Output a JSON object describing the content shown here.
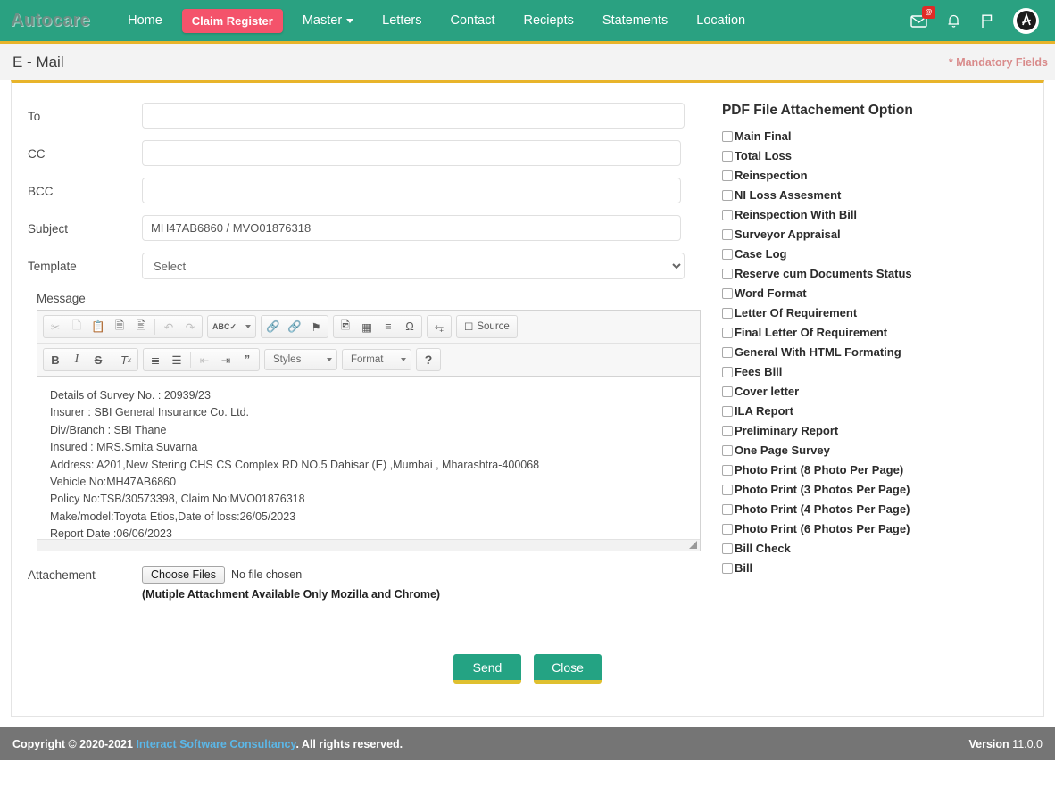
{
  "navbar": {
    "brand": "Autocare",
    "links": [
      {
        "label": "Home",
        "type": "link"
      },
      {
        "label": "Claim Register",
        "type": "pill"
      },
      {
        "label": "Master",
        "type": "dropdown"
      },
      {
        "label": "Letters",
        "type": "link"
      },
      {
        "label": "Contact",
        "type": "link"
      },
      {
        "label": "Reciepts",
        "type": "link"
      },
      {
        "label": "Statements",
        "type": "link"
      },
      {
        "label": "Location",
        "type": "link"
      }
    ],
    "icons": [
      {
        "name": "mail-icon",
        "badge": "@"
      },
      {
        "name": "bell-icon",
        "badge": ""
      },
      {
        "name": "flag-icon",
        "badge": ""
      },
      {
        "name": "avatar",
        "badge": ""
      }
    ],
    "mail_badge": "@",
    "bg_color": "#2aa181",
    "pill_color": "#f4536b"
  },
  "page": {
    "title": "E - Mail",
    "mandatory_note": "* Mandatory Fields",
    "accent_color": "#e8b42a"
  },
  "form": {
    "to": {
      "label": "To",
      "value": "",
      "placeholder": ""
    },
    "cc": {
      "label": "CC",
      "value": "",
      "placeholder": ""
    },
    "bcc": {
      "label": "BCC",
      "value": "",
      "placeholder": ""
    },
    "subject": {
      "label": "Subject",
      "value": "MH47AB6860 / MVO01876318",
      "placeholder": ""
    },
    "template": {
      "label": "Template",
      "selected": "Select",
      "options": [
        "Select"
      ]
    },
    "message_label": "Message"
  },
  "editor": {
    "toolbar_row1": [
      {
        "group": [
          {
            "name": "cut-icon",
            "glyph": "✂"
          },
          {
            "name": "copy-icon",
            "glyph": "❐"
          },
          {
            "name": "paste-icon",
            "glyph": "ὌB"
          },
          {
            "name": "paste-text-icon",
            "glyph": "T"
          },
          {
            "name": "paste-word-icon",
            "glyph": "W"
          },
          {
            "name": "separator",
            "glyph": "|"
          },
          {
            "name": "undo-icon",
            "glyph": "↶"
          },
          {
            "name": "redo-icon",
            "glyph": "↷"
          }
        ]
      },
      {
        "group": [
          {
            "name": "spellcheck-icon",
            "glyph": "ABC"
          }
        ]
      },
      {
        "group": [
          {
            "name": "link-icon",
            "glyph": "ὑ7"
          },
          {
            "name": "unlink-icon",
            "glyph": "⛓"
          },
          {
            "name": "anchor-icon",
            "glyph": "⚑"
          }
        ]
      },
      {
        "group": [
          {
            "name": "image-icon",
            "glyph": "ὛC"
          },
          {
            "name": "table-icon",
            "glyph": "⊞"
          },
          {
            "name": "horizontal-rule-icon",
            "glyph": "≡"
          },
          {
            "name": "special-char-icon",
            "glyph": "Ω"
          }
        ]
      },
      {
        "group": [
          {
            "name": "maximize-icon",
            "glyph": "⤢"
          }
        ]
      },
      {
        "group": [
          {
            "name": "source-button",
            "glyph": "Source"
          }
        ]
      }
    ],
    "source_label": "Source",
    "toolbar_row2": [
      {
        "group": [
          {
            "name": "bold-icon",
            "glyph": "B"
          },
          {
            "name": "italic-icon",
            "glyph": "I"
          },
          {
            "name": "strikethrough-icon",
            "glyph": "S"
          },
          {
            "name": "remove-format-icon",
            "glyph": "Tx"
          }
        ]
      },
      {
        "group": [
          {
            "name": "numbered-list-icon",
            "glyph": "≣"
          },
          {
            "name": "bulleted-list-icon",
            "glyph": "☰"
          },
          {
            "name": "outdent-icon",
            "glyph": "⇤"
          },
          {
            "name": "indent-icon",
            "glyph": "⇥"
          },
          {
            "name": "blockquote-icon",
            "glyph": "”"
          }
        ]
      },
      {
        "group": [
          {
            "name": "help-icon",
            "glyph": "?"
          }
        ]
      }
    ],
    "styles_label": "Styles",
    "format_label": "Format",
    "help_label": "?",
    "body_lines": [
      "Details of Survey No. : 20939/23",
      "Insurer : SBI General Insurance Co. Ltd.",
      "Div/Branch : SBI Thane",
      "Insured : MRS.Smita Suvarna",
      "Address: A201,New Stering CHS CS Complex RD NO.5 Dahisar (E) ,Mumbai , Mharashtra-400068",
      "Vehicle No:MH47AB6860",
      "Policy No:TSB/30573398, Claim No:MVO01876318",
      "Make/model:Toyota Etios,Date of loss:26/05/2023",
      "Report Date :06/06/2023"
    ]
  },
  "attachment": {
    "label": "Attachement",
    "choose_button": "Choose Files",
    "no_file_text": "No file chosen",
    "note": "(Mutiple Attachment Available Only Mozilla and Chrome)"
  },
  "actions": {
    "send_label": "Send",
    "close_label": "Close"
  },
  "pdf_options": {
    "title": "PDF File Attachement Option",
    "items": [
      {
        "label": "Main Final",
        "checked": false
      },
      {
        "label": "Total Loss",
        "checked": false
      },
      {
        "label": "Reinspection",
        "checked": false
      },
      {
        "label": "NI Loss Assesment",
        "checked": false
      },
      {
        "label": "Reinspection With Bill",
        "checked": false
      },
      {
        "label": "Surveyor Appraisal",
        "checked": false
      },
      {
        "label": "Case Log",
        "checked": false
      },
      {
        "label": "Reserve cum Documents Status",
        "checked": false
      },
      {
        "label": "Word Format",
        "checked": false
      },
      {
        "label": "Letter Of Requirement",
        "checked": false
      },
      {
        "label": "Final Letter Of Requirement",
        "checked": false
      },
      {
        "label": "General With HTML Formating",
        "checked": false
      },
      {
        "label": "Fees Bill",
        "checked": false
      },
      {
        "label": "Cover letter",
        "checked": false
      },
      {
        "label": "ILA Report",
        "checked": false
      },
      {
        "label": "Preliminary Report",
        "checked": false
      },
      {
        "label": "One Page Survey",
        "checked": false
      },
      {
        "label": "Photo Print (8 Photo Per Page)",
        "checked": false
      },
      {
        "label": "Photo Print (3 Photos Per Page)",
        "checked": false
      },
      {
        "label": "Photo Print (4 Photos Per Page)",
        "checked": false
      },
      {
        "label": "Photo Print (6 Photos Per Page)",
        "checked": false
      },
      {
        "label": "Bill Check",
        "checked": false
      },
      {
        "label": "Bill",
        "checked": false
      }
    ]
  },
  "footer": {
    "copyright_prefix": "Copyright © 2020-2021",
    "company": "Interact Software Consultancy",
    "rights": ". All rights reserved.",
    "version_label": "Version",
    "version_number": "11.0.0"
  }
}
